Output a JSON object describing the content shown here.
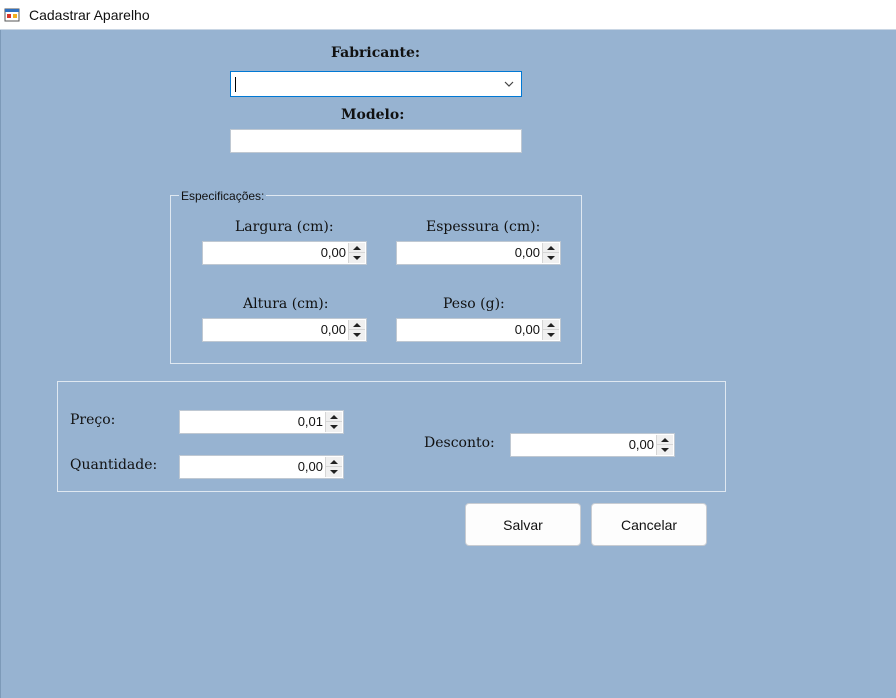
{
  "window": {
    "title": "Cadastrar Aparelho"
  },
  "form": {
    "fabricante_label": "Fabricante:",
    "fabricante_value": "",
    "modelo_label": "Modelo:",
    "modelo_value": ""
  },
  "especificacoes": {
    "legend": "Especificações:",
    "largura": {
      "label": "Largura (cm):",
      "value": "0,00"
    },
    "espessura": {
      "label": "Espessura (cm):",
      "value": "0,00"
    },
    "altura": {
      "label": "Altura (cm):",
      "value": "0,00"
    },
    "peso": {
      "label": "Peso (g):",
      "value": "0,00"
    }
  },
  "pricing": {
    "preco": {
      "label": "Preço:",
      "value": "0,01"
    },
    "quantidade": {
      "label": "Quantidade:",
      "value": "0,00"
    },
    "desconto": {
      "label": "Desconto:",
      "value": "0,00"
    }
  },
  "buttons": {
    "save": "Salvar",
    "cancel": "Cancelar"
  },
  "colors": {
    "background": "#97b3d1",
    "focus_border": "#0078d4"
  }
}
